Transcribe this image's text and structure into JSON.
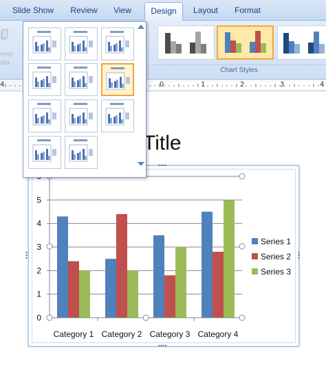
{
  "ribbon": {
    "tabs": [
      {
        "label": "Slide Show",
        "active": false
      },
      {
        "label": "Review",
        "active": false
      },
      {
        "label": "View",
        "active": false
      },
      {
        "label": "Design",
        "active": true
      },
      {
        "label": "Layout",
        "active": false
      },
      {
        "label": "Format",
        "active": false
      }
    ],
    "refresh_label_line1": "resh",
    "refresh_label_line2": "ata",
    "chart_styles_label": "Chart Styles"
  },
  "ruler": {
    "numbers": [
      "4",
      "0",
      "1",
      "2",
      "3",
      "4"
    ]
  },
  "slide": {
    "title": "Title"
  },
  "colors": {
    "series1": "#4f81bd",
    "series2": "#c0504d",
    "series3": "#9bbb59",
    "ribbon_text": "#15428b",
    "selection_orange": "#f3a53a"
  },
  "chart_data": {
    "type": "bar",
    "title": "",
    "xlabel": "",
    "ylabel": "",
    "categories": [
      "Category 1",
      "Category 2",
      "Category 3",
      "Category 4"
    ],
    "series": [
      {
        "name": "Series 1",
        "values": [
          4.3,
          2.5,
          3.5,
          4.5
        ]
      },
      {
        "name": "Series 2",
        "values": [
          2.4,
          4.4,
          1.8,
          2.8
        ]
      },
      {
        "name": "Series 3",
        "values": [
          2,
          2,
          3,
          5
        ]
      }
    ],
    "ylim": [
      0,
      6
    ],
    "yticks": [
      "0",
      "1",
      "2",
      "3",
      "4",
      "5",
      "6"
    ],
    "grid": true,
    "legend_position": "right"
  }
}
